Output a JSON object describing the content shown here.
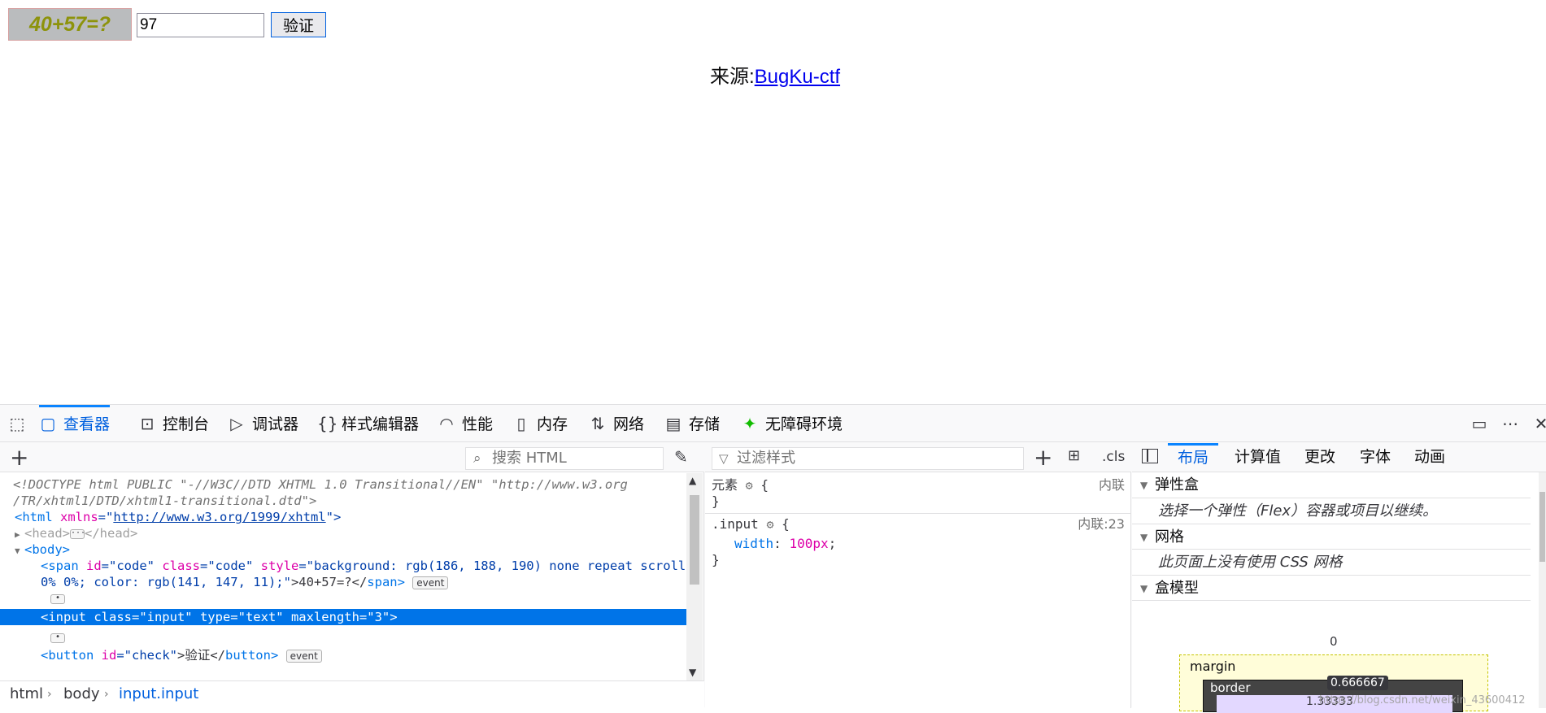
{
  "page": {
    "captcha_text": "40+57=?",
    "input_value": "97",
    "verify_button": "验证",
    "source_label": "来源:",
    "source_link": "BugKu-ctf",
    "colors": {
      "captcha_bg": "#babcbe",
      "captcha_fg": "#8d930b",
      "link": "#0000ee"
    }
  },
  "devtools": {
    "tabs": [
      {
        "label": "查看器",
        "icon": "inspector-icon"
      },
      {
        "label": "控制台",
        "icon": "console-icon"
      },
      {
        "label": "调试器",
        "icon": "debugger-icon"
      },
      {
        "label": "样式编辑器",
        "icon": "braces-icon"
      },
      {
        "label": "性能",
        "icon": "gauge-icon"
      },
      {
        "label": "内存",
        "icon": "memory-icon"
      },
      {
        "label": "网络",
        "icon": "network-icon"
      },
      {
        "label": "存储",
        "icon": "storage-icon"
      },
      {
        "label": "无障碍环境",
        "icon": "accessibility-icon"
      }
    ],
    "active_tab": "查看器",
    "markup": {
      "search_placeholder": "搜索 HTML",
      "lines": {
        "doctype1": "<!DOCTYPE html PUBLIC \"-//W3C//DTD XHTML 1.0 Transitional//EN\" \"http://www.w3.org",
        "doctype2": "/TR/xhtml1/DTD/xhtml1-transitional.dtd\">",
        "html_open_tag": "<html",
        "html_attr": " xmlns",
        "html_eq": "=\"",
        "html_xmlns": "http://www.w3.org/1999/xhtml",
        "html_close": "\">",
        "head_open": "<head>",
        "head_close": "</head>",
        "body_open": "<body>",
        "span_tag": "<span",
        "span_id_attr": " id",
        "span_id_val": "=\"code\"",
        "span_class_attr": " class",
        "span_class_val": "=\"code\"",
        "span_style_attr": " style",
        "span_style_val1": "=\"background: rgb(186, 188, 190) none repeat scroll",
        "span_style_val2": "0% 0%; color: rgb(141, 147, 11);\"",
        "span_text": ">40+57=?</",
        "span_close": "span>",
        "input_line": "<input class=\"input\" type=\"text\" maxlength=\"3\">",
        "button_tag": "<button",
        "button_id_attr": " id",
        "button_id_val": "=\"check\"",
        "button_text": ">验证</",
        "button_close": "button>"
      },
      "event_badge": "event",
      "breadcrumbs": [
        "html",
        "body",
        "input.input"
      ]
    },
    "rules": {
      "filter_placeholder": "过滤样式",
      "cls_label": ".cls",
      "element_selector": "元素",
      "element_source": "内联",
      "input_selector": ".input",
      "input_source": "内联:23",
      "prop_name": "width",
      "prop_value": "100px",
      "brace_open": "{",
      "brace_close": "}"
    },
    "layout": {
      "tabs": [
        "布局",
        "计算值",
        "更改",
        "字体",
        "动画"
      ],
      "active_tab": "布局",
      "sections": [
        {
          "title": "弹性盒",
          "note": "选择一个弹性（Flex）容器或项目以继续。"
        },
        {
          "title": "网格",
          "note": "此页面上没有使用 CSS 网格"
        },
        {
          "title": "盒模型"
        }
      ],
      "box_model": {
        "margin_label": "margin",
        "margin_top": "0",
        "border_label": "border",
        "border_tooltip": "0.666667",
        "padding_value": "1.33333"
      }
    },
    "watermark": "https://blog.csdn.net/weixin_43600412"
  }
}
